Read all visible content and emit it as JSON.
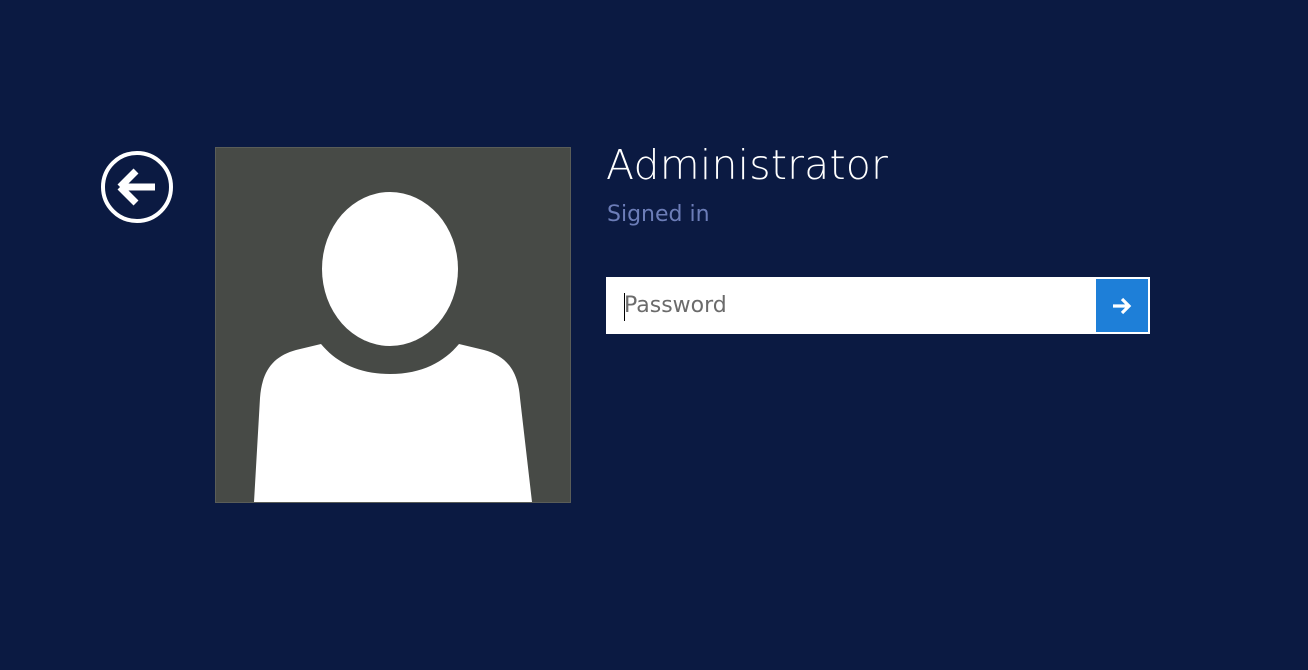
{
  "theme": {
    "background": "#0b1a42",
    "avatar_background": "#474a46",
    "accent": "#1e7fd8",
    "status_text": "#6c7db8"
  },
  "navigation": {
    "back_icon": "arrow-left-circle-icon"
  },
  "user": {
    "avatar_icon": "default-user-silhouette",
    "name": "Administrator",
    "status": "Signed in"
  },
  "login": {
    "password_placeholder": "Password",
    "password_value": "",
    "submit_icon": "arrow-right-icon"
  }
}
